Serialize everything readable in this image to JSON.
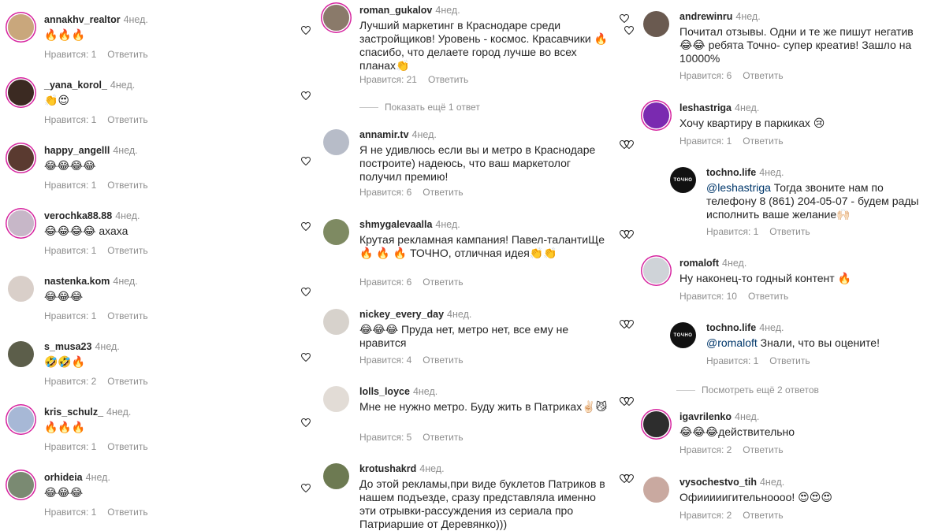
{
  "col1": [
    {
      "user": "annakhv_realtor",
      "time": "4нед.",
      "text": "🔥🔥🔥",
      "likes": "Нравится: 1",
      "reply": "Ответить",
      "av": "#c9a77c"
    },
    {
      "user": "_yana_korol_",
      "time": "4нед.",
      "text": "👏😍",
      "likes": "Нравится: 1",
      "reply": "Ответить",
      "av": "#3b2a22"
    },
    {
      "user": "happy_angelll",
      "time": "4нед.",
      "text": "😂😂😂😂",
      "likes": "Нравится: 1",
      "reply": "Ответить",
      "av": "#5a3a30"
    },
    {
      "user": "verochka88.88",
      "time": "4нед.",
      "text": "😂😂😂😂 ахаха",
      "likes": "Нравится: 1",
      "reply": "Ответить",
      "av": "#c7b7c8"
    },
    {
      "user": "nastenka.kom",
      "time": "4нед.",
      "text": "😂😂😂",
      "likes": "Нравится: 1",
      "reply": "Ответить",
      "av": "#d9cfc9"
    },
    {
      "user": "s_musa23",
      "time": "4нед.",
      "text": "🤣🤣🔥",
      "likes": "Нравится: 2",
      "reply": "Ответить",
      "av": "#5c5e4a"
    },
    {
      "user": "kris_schulz_",
      "time": "4нед.",
      "text": "🔥🔥🔥",
      "likes": "Нравится: 1",
      "reply": "Ответить",
      "av": "#a7b8d6"
    },
    {
      "user": "orhideia",
      "time": "4нед.",
      "text": "😂😂😂",
      "likes": "Нравится: 1",
      "reply": "Ответить",
      "av": "#7a8a72"
    }
  ],
  "col2": [
    {
      "user": "roman_gukalov",
      "time": "4нед.",
      "text": "Лучший маркетинг в Краснодаре среди застройщиков! Уровень - космос. Красавчики 🔥 спасибо, что делаете город лучше во всех планах👏",
      "likes": "Нравится: 21",
      "reply": "Ответить",
      "av": "#8a7a6a"
    },
    {
      "user": "annamir.tv",
      "time": "4нед.",
      "text": "Я не удивлюсь если вы и метро в Краснодаре построите) надеюсь, что ваш маркетолог получил премию!",
      "likes": "Нравится: 6",
      "reply": "Ответить",
      "av": "#b7bcc8"
    },
    {
      "user": "shmygalevaalla",
      "time": "4нед.",
      "text": "Крутая рекламная кампания! Павел-талантиЩе🔥 🔥 🔥 ТОЧНО, отличная идея👏👏",
      "likes": "Нравится: 6",
      "reply": "Ответить",
      "av": "#7e8a62"
    },
    {
      "user": "nickey_every_day",
      "time": "4нед.",
      "text": "😂😂😂 Пруда нет, метро нет, все ему не нравится",
      "likes": "Нравится: 4",
      "reply": "Ответить",
      "av": "#d7d2cc"
    },
    {
      "user": "lolls_loyce",
      "time": "4нед.",
      "text": "Мне не нужно метро. Буду жить в Патриках✌🏻😼",
      "likes": "Нравится: 5",
      "reply": "Ответить",
      "av": "#e2dcd6"
    },
    {
      "user": "krotushakrd",
      "time": "4нед.",
      "text": "До этой рекламы,при виде буклетов Патриков в нашем подъезде, сразу представляла именно эти отрывки-рассуждения  из сериала про Патриаршие от Деревянко)))",
      "likes": "",
      "reply": "",
      "av": "#6d7a52"
    }
  ],
  "col2_more": "Показать ещё 1 ответ",
  "col3": [
    {
      "user": "andrewinru",
      "time": "4нед.",
      "text": "Почитал отзывы. Одни и те же пишут негатив 😂😂 ребята Точно- супер креатив! Зашло на 10000%",
      "likes": "Нравится: 6",
      "reply": "Ответить",
      "av": "#6a5a50"
    },
    {
      "user": "leshastriga",
      "time": "4нед.",
      "text": "Хочу квартиру в паркиках 😢",
      "likes": "Нравится: 1",
      "reply": "Ответить",
      "av": "#7a2ab0"
    },
    {
      "user": "techno_reply1",
      "display": "tochno.life",
      "time": "4нед.",
      "mention": "@leshastriga",
      "text": " Тогда звоните нам по телефону 8 (861) 204-05-07 - будем рады исполнить ваше желание🙌🏻",
      "likes": "Нравится: 1",
      "reply": "Ответить"
    },
    {
      "user": "romaloft",
      "time": "4нед.",
      "text": "Ну наконец-то годный контент 🔥",
      "likes": "Нравится: 10",
      "reply": "Ответить",
      "av": "#cfd3d8"
    },
    {
      "user": "techno_reply2",
      "display": "tochno.life",
      "time": "4нед.",
      "mention": "@romaloft",
      "text": " Знали, что вы оцените!",
      "likes": "Нравится: 1",
      "reply": "Ответить"
    },
    {
      "user": "igavrilenko",
      "time": "4нед.",
      "text": "😂😂😂действительно",
      "likes": "Нравится: 2",
      "reply": "Ответить",
      "av": "#2d2d2d"
    },
    {
      "user": "vysochestvo_tih",
      "time": "4нед.",
      "text": "Офииииигительноооо! 😍😍😍",
      "likes": "Нравится: 2",
      "reply": "Ответить",
      "av": "#c9a9a0"
    }
  ],
  "col3_more": "Посмотреть ещё 2 ответов",
  "logo_text": "ТОЧНО"
}
